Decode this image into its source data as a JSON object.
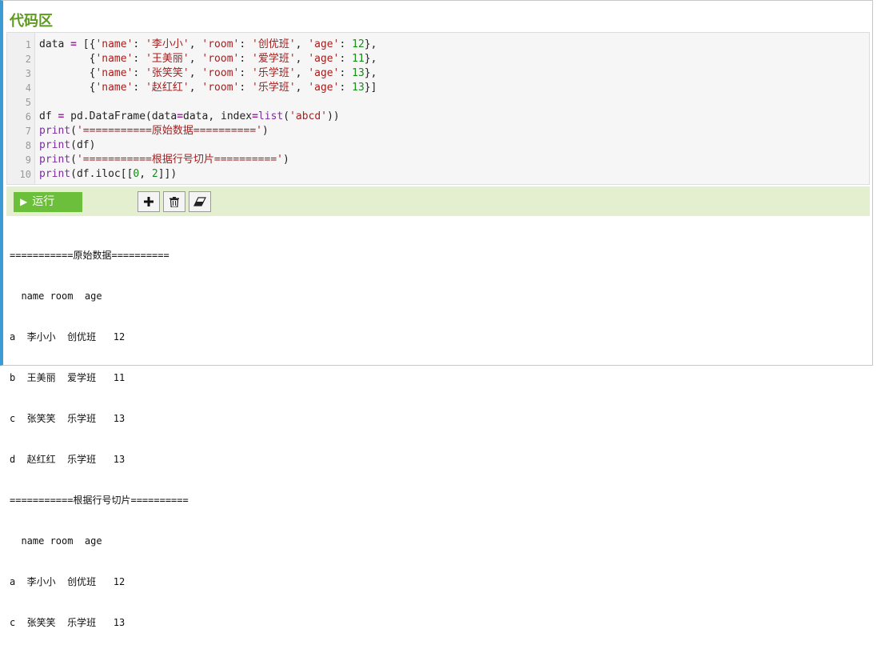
{
  "panel": {
    "title": "代码区"
  },
  "editor": {
    "line_numbers": [
      "1",
      "2",
      "3",
      "4",
      "5",
      "6",
      "7",
      "8",
      "9",
      "10"
    ]
  },
  "toolbar": {
    "run_label": "运行",
    "add_icon": "plus-icon",
    "delete_icon": "trash-icon",
    "clear_icon": "eraser-icon"
  },
  "output": {
    "lines": [
      "===========原始数据==========",
      "  name room  age",
      "a  李小小  创优班   12",
      "b  王美丽  爱学班   11",
      "c  张笑笑  乐学班   13",
      "d  赵红红  乐学班   13",
      "===========根据行号切片==========",
      "  name room  age",
      "a  李小小  创优班   12",
      "c  张笑笑  乐学班   13"
    ]
  },
  "colors": {
    "accent_border": "#3c9ad4",
    "title": "#5d9a1e",
    "toolbar_bg": "#e4efcf",
    "run_button": "#6cbf3a"
  }
}
